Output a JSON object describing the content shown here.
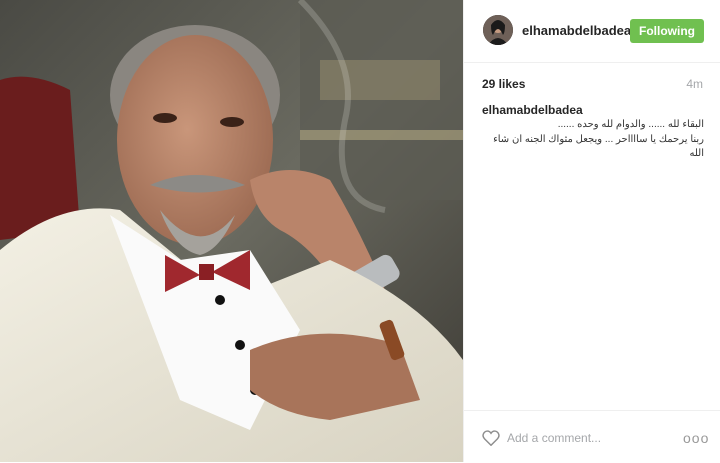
{
  "post": {
    "username": "elhamabdelbadea",
    "follow_label": "Following",
    "likes": "29 likes",
    "time": "4m",
    "caption": {
      "username": "elhamabdelbadea",
      "line1": "البقاء لله ...... والدوام لله وحده ......",
      "line2": "ربنا يرحمك يا سااااحر ... ويجعل مثواك الجنه ان شاء الله"
    },
    "comment_placeholder": "Add a comment...",
    "more_label": "ooo"
  },
  "colors": {
    "follow_button": "#70c050",
    "text": "#262626",
    "muted": "#a5a7aa"
  },
  "icons": {
    "like": "heart-icon",
    "more": "more-options-icon"
  }
}
